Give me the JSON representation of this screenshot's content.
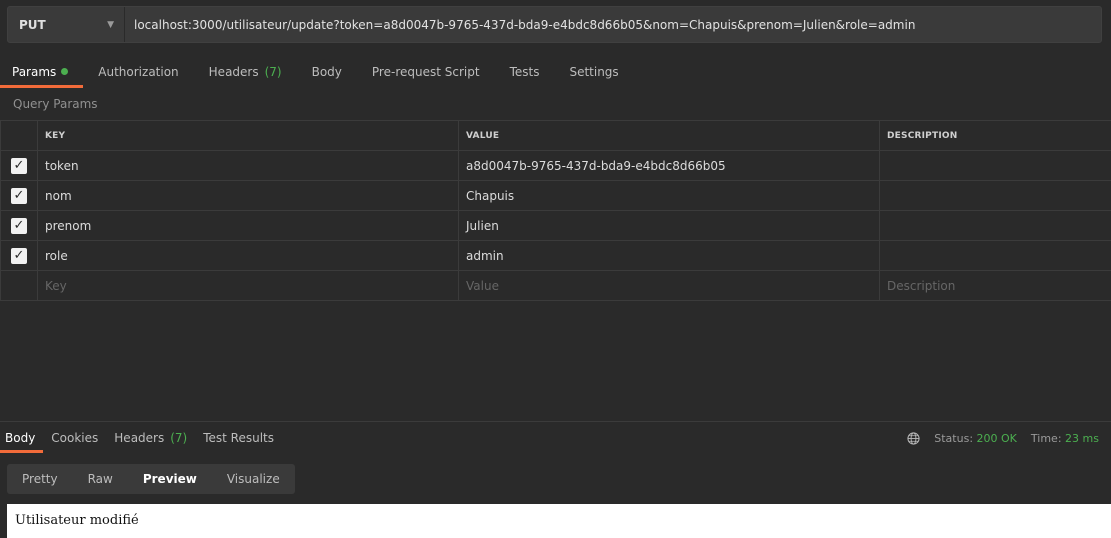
{
  "request": {
    "method": "PUT",
    "url": "localhost:3000/utilisateur/update?token=a8d0047b-9765-437d-bda9-e4bdc8d66b05&nom=Chapuis&prenom=Julien&role=admin"
  },
  "request_tabs": [
    {
      "label": "Params",
      "active": true
    },
    {
      "label": "Authorization"
    },
    {
      "label": "Headers",
      "count": "(7)"
    },
    {
      "label": "Body"
    },
    {
      "label": "Pre-request Script"
    },
    {
      "label": "Tests"
    },
    {
      "label": "Settings"
    }
  ],
  "query_params": {
    "title": "Query Params",
    "headers": {
      "key": "KEY",
      "value": "VALUE",
      "description": "DESCRIPTION"
    },
    "rows": [
      {
        "key": "token",
        "value": "a8d0047b-9765-437d-bda9-e4bdc8d66b05",
        "description": ""
      },
      {
        "key": "nom",
        "value": "Chapuis",
        "description": ""
      },
      {
        "key": "prenom",
        "value": "Julien",
        "description": ""
      },
      {
        "key": "role",
        "value": "admin",
        "description": ""
      }
    ],
    "placeholders": {
      "key": "Key",
      "value": "Value",
      "description": "Description"
    }
  },
  "response_tabs": [
    {
      "label": "Body",
      "active": true
    },
    {
      "label": "Cookies"
    },
    {
      "label": "Headers",
      "count": "(7)"
    },
    {
      "label": "Test Results"
    }
  ],
  "response_status": {
    "status_label": "Status:",
    "status_value": "200 OK",
    "time_label": "Time:",
    "time_value": "23 ms"
  },
  "view_tabs": [
    "Pretty",
    "Raw",
    "Preview",
    "Visualize"
  ],
  "preview_text": "Utilisateur modifié",
  "colors": {
    "accent": "#f26b3a",
    "success": "#4caf50"
  }
}
